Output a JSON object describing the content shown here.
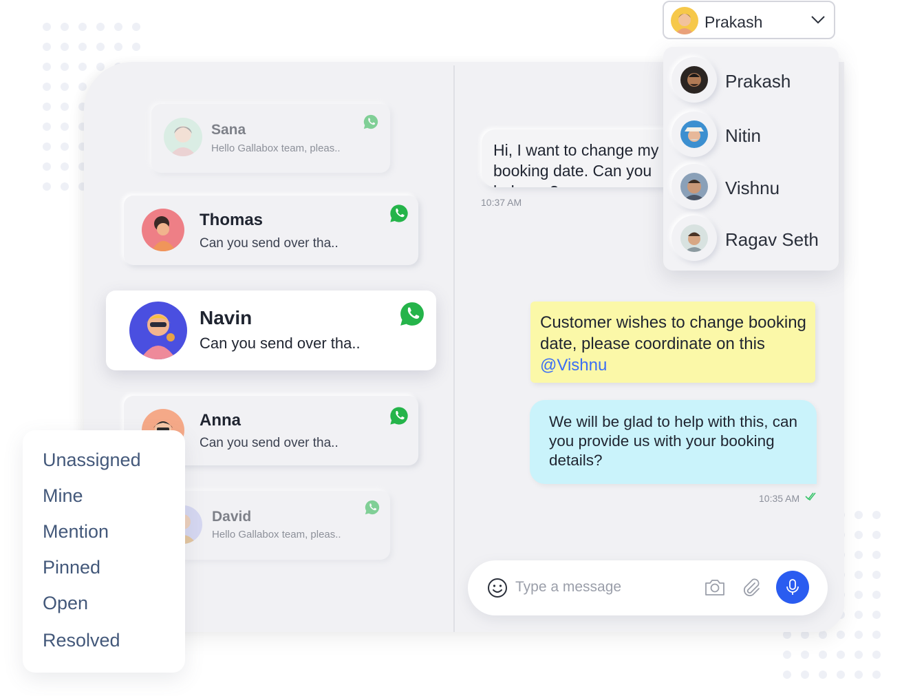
{
  "colors": {
    "accent_blue": "#2a5cf0",
    "whatsapp_green": "#25b44a",
    "note_yellow": "#fbf8a8",
    "reply_cyan": "#caf3fb",
    "filter_text": "#43587a"
  },
  "conversations": [
    {
      "name": "Sana",
      "preview": "Hello Gallabox team, pleas..",
      "channel_icon": "whatsapp-icon",
      "state": "faded"
    },
    {
      "name": "Thomas",
      "preview": "Can you send over tha..",
      "channel_icon": "whatsapp-icon",
      "state": "normal"
    },
    {
      "name": "Navin",
      "preview": "Can you send over tha..",
      "channel_icon": "whatsapp-icon",
      "state": "active"
    },
    {
      "name": "Anna",
      "preview": "Can you send over tha..",
      "channel_icon": "whatsapp-icon",
      "state": "normal"
    },
    {
      "name": "David",
      "preview": "Hello Gallabox team, pleas..",
      "channel_icon": "whatsapp-icon",
      "state": "faded"
    }
  ],
  "chat": {
    "incoming_message": "Hi, I want to change my booking date. Can you help me?",
    "incoming_time": "10:37 AM",
    "note_text": "Customer wishes to change booking date, please coordinate on this ",
    "note_mention": "@Vishnu",
    "reply_message": "We will be glad to help with this, can you provide us with your booking details?",
    "reply_time": "10:35 AM",
    "reply_status_icon": "double-check-icon"
  },
  "composer": {
    "placeholder": "Type a message",
    "icons": [
      "smiley-icon",
      "camera-icon",
      "paperclip-icon",
      "microphone-icon"
    ]
  },
  "agent_selector": {
    "selected": "Prakash",
    "options": [
      "Prakash",
      "Nitin",
      "Vishnu",
      "Ragav Seth"
    ]
  },
  "filters": [
    "Unassigned",
    "Mine",
    "Mention",
    "Pinned",
    "Open",
    "Resolved"
  ]
}
